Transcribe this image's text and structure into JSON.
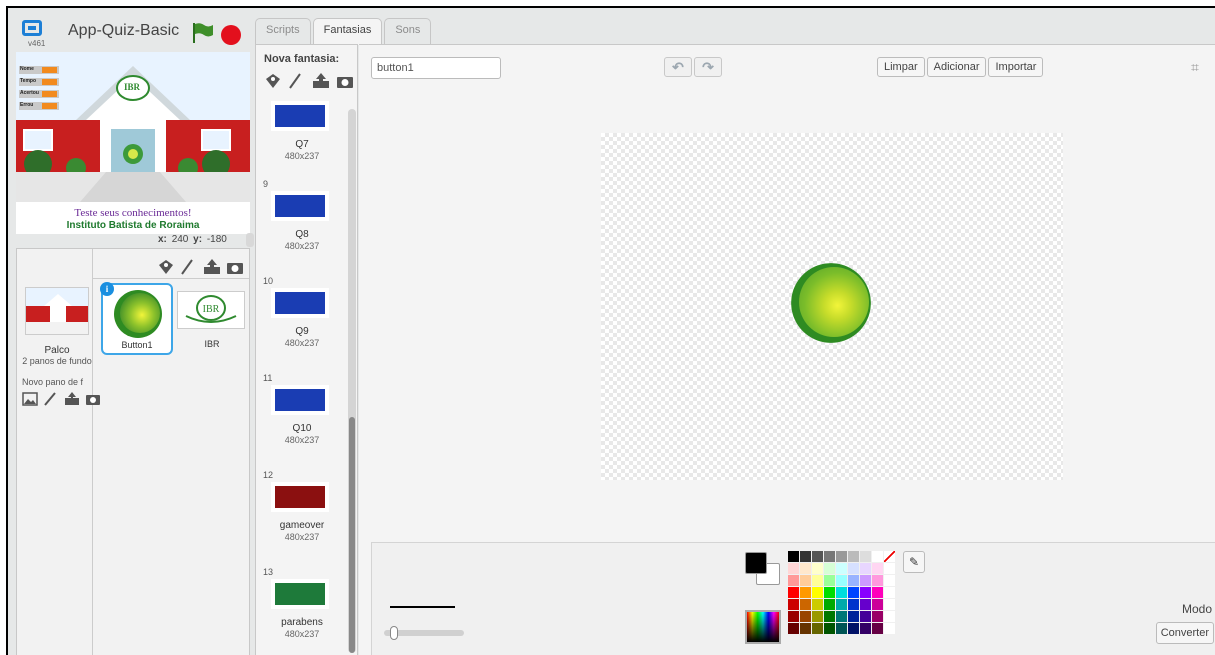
{
  "app": {
    "version": "v461",
    "project_title": "App-Quiz-Basic"
  },
  "stage": {
    "monitors": [
      "Nome",
      "Tempo",
      "Acertou",
      "Errou"
    ],
    "logo_text": "IBR",
    "caption_line1": "Teste seus conhecimentos!",
    "caption_line2": "Instituto Batista de Roraima",
    "x_label": "x:",
    "x_value": "240",
    "y_label": "y:",
    "y_value": "-180"
  },
  "sprite_pane": {
    "palco_label": "Palco",
    "palco_sub": "2 panos de fundo",
    "novo_pano": "Novo pano de f",
    "sprites": [
      {
        "name": "Button1",
        "selected": true,
        "info": "i"
      },
      {
        "name": "IBR",
        "selected": false
      }
    ]
  },
  "tabs": [
    "Scripts",
    "Fantasias",
    "Sons"
  ],
  "active_tab": "Fantasias",
  "costumes": {
    "new_label": "Nova fantasia:",
    "items": [
      {
        "num": "",
        "name": "Q7",
        "size": "480x237",
        "color": "#1a3db3"
      },
      {
        "num": "9",
        "name": "Q8",
        "size": "480x237",
        "color": "#1a3db3"
      },
      {
        "num": "10",
        "name": "Q9",
        "size": "480x237",
        "color": "#1a3db3"
      },
      {
        "num": "11",
        "name": "Q10",
        "size": "480x237",
        "color": "#1a3db3"
      },
      {
        "num": "12",
        "name": "gameover",
        "size": "480x237",
        "color": "#8b1010"
      },
      {
        "num": "13",
        "name": "parabens",
        "size": "480x237",
        "color": "#1e7a3a"
      }
    ]
  },
  "editor": {
    "costume_name": "button1",
    "undo": "↶",
    "redo": "↷",
    "clear_label": "Limpar",
    "add_label": "Adicionar",
    "import_label": "Importar",
    "mode_label": "Modo",
    "convert_label": "Converter"
  },
  "palette": [
    "#000000",
    "#333333",
    "#555555",
    "#777777",
    "#999999",
    "#bbbbbb",
    "#dddddd",
    "#ffffff",
    "transparent",
    "#ffd6d6",
    "#ffe8cc",
    "#ffffcc",
    "#d6ffd6",
    "#ccffff",
    "#d6e0ff",
    "#e8d6ff",
    "#ffd6f2",
    "#ffffff",
    "#ff9999",
    "#ffcc99",
    "#ffff99",
    "#99ff99",
    "#99ffff",
    "#99b3ff",
    "#cc99ff",
    "#ff99dd",
    "#ffffff",
    "#ff0000",
    "#ff9900",
    "#ffff00",
    "#00dd00",
    "#00dddd",
    "#0044ff",
    "#8800ff",
    "#ff00bb",
    "#ffffff",
    "#cc0000",
    "#cc6600",
    "#cccc00",
    "#00aa00",
    "#00aaaa",
    "#0033cc",
    "#6600cc",
    "#cc0099",
    "#ffffff",
    "#990000",
    "#994400",
    "#999900",
    "#007700",
    "#007777",
    "#002299",
    "#440099",
    "#990066",
    "#ffffff",
    "#660000",
    "#663300",
    "#666600",
    "#005500",
    "#005555",
    "#001166",
    "#330066",
    "#660044",
    "#ffffff"
  ]
}
